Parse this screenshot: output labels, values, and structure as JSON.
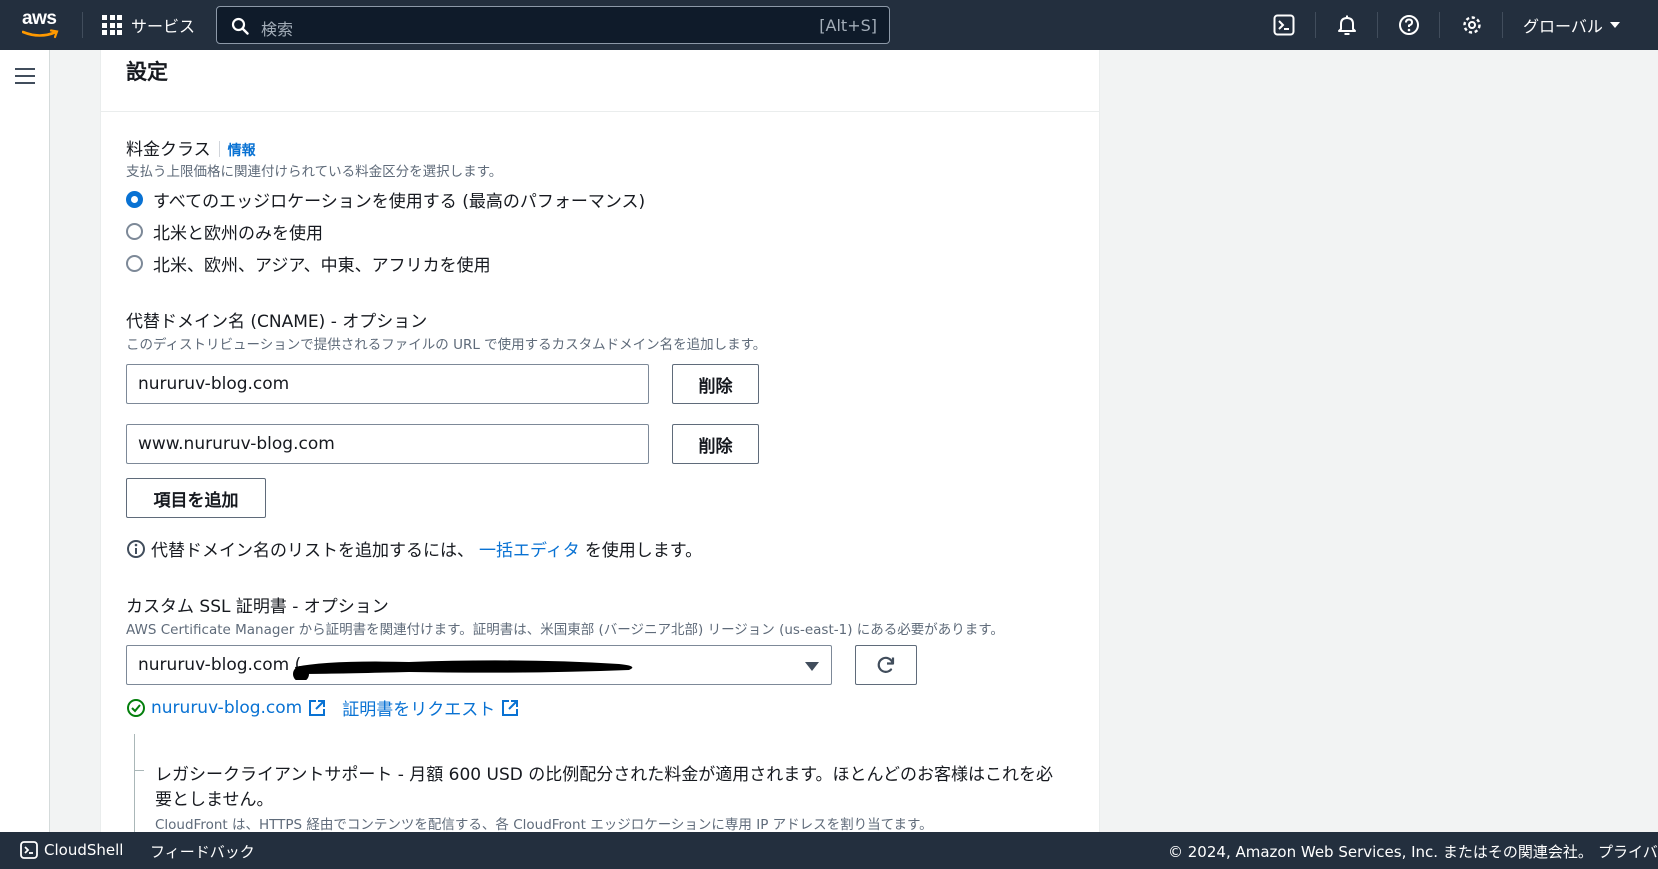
{
  "nav": {
    "logo_text": "aws",
    "services_label": "サービス",
    "search_placeholder": "検索",
    "search_shortcut": "[Alt+S]",
    "region_label": "グローバル"
  },
  "card": {
    "title": "設定"
  },
  "price_class": {
    "label": "料金クラス",
    "info_link": "情報",
    "description": "支払う上限価格に関連付けられている料金区分を選択します。",
    "options": [
      {
        "label": "すべてのエッジロケーションを使用する (最高のパフォーマンス)",
        "checked": true
      },
      {
        "label": "北米と欧州のみを使用",
        "checked": false
      },
      {
        "label": "北米、欧州、アジア、中東、アフリカを使用",
        "checked": false
      }
    ]
  },
  "cname": {
    "label": "代替ドメイン名 (CNAME) - オプション",
    "description": "このディストリビューションで提供されるファイルの URL で使用するカスタムドメイン名を追加します。",
    "items": [
      {
        "value": "nururuv-blog.com",
        "remove_label": "削除"
      },
      {
        "value": "www.nururuv-blog.com",
        "remove_label": "削除"
      }
    ],
    "add_label": "項目を追加",
    "hint_prefix": "代替ドメイン名のリストを追加するには、",
    "hint_link": "一括エディタ",
    "hint_suffix": "を使用します。"
  },
  "ssl": {
    "label": "カスタム SSL 証明書 - オプション",
    "description": "AWS Certificate Manager から証明書を関連付けます。証明書は、米国東部 (バージニア北部) リージョン (us-east-1) にある必要があります。",
    "selected_value": "nururuv-blog.com (",
    "cert_link": "nururuv-blog.com",
    "request_link": "証明書をリクエスト"
  },
  "legacy": {
    "text_line1": "レガシークライアントサポート - 月額 600 USD の比例配分された料金が適用されます。ほとんどのお客様はこれを必",
    "text_line2": "要としません。",
    "description": "CloudFront は、HTTPS 経由でコンテンツを配信する、各 CloudFront エッジロケーションに専用 IP アドレスを割り当てます。"
  },
  "footer": {
    "cloudshell": "CloudShell",
    "feedback": "フィードバック",
    "copyright": "© 2024, Amazon Web Services, Inc. またはその関連会社。",
    "privacy": "プライバ"
  },
  "colors": {
    "nav_bg": "#232f3e",
    "link": "#0972d3",
    "success": "#037f0c"
  }
}
